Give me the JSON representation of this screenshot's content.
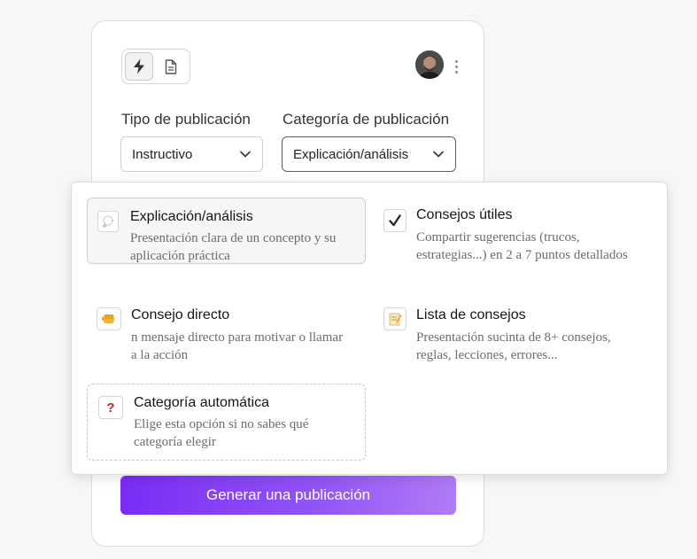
{
  "form": {
    "post_type_label": "Tipo de publicación",
    "post_type_value": "Instructivo",
    "category_label": "Categoría de publicación",
    "category_value": "Explicación/análisis",
    "generate_label": "Generar una publicación"
  },
  "toolbar": {
    "modes": [
      {
        "icon": "lightning-icon",
        "active": true
      },
      {
        "icon": "document-icon",
        "active": false
      }
    ]
  },
  "dropdown": {
    "options": [
      {
        "title": "Explicación/análisis",
        "description": "Presentación clara de un concepto y su aplicación práctica",
        "icon": "thought-bubble-icon",
        "selected": true
      },
      {
        "title": "Consejos útiles",
        "description": "Compartir sugerencias (trucos, estrategias...) en 2 a 7 puntos detallados",
        "icon": "checkmark-icon",
        "selected": false
      },
      {
        "title": "Consejo directo",
        "description": "n mensaje directo para motivar o llamar a la acción",
        "icon": "fist-icon",
        "selected": false
      },
      {
        "title": "Lista de consejos",
        "description": "Presentación sucinta de 8+ consejos, reglas, lecciones, errores...",
        "icon": "memo-icon",
        "selected": false
      },
      {
        "title": "Categoría automática",
        "description": "Elige esta opción si no sabes qué categoría elegir",
        "icon": "question-mark-icon",
        "selected": false
      }
    ]
  },
  "colors": {
    "accent_start": "#7a2cf5",
    "accent_end": "#b07cf7",
    "question_red": "#d21f1f"
  }
}
